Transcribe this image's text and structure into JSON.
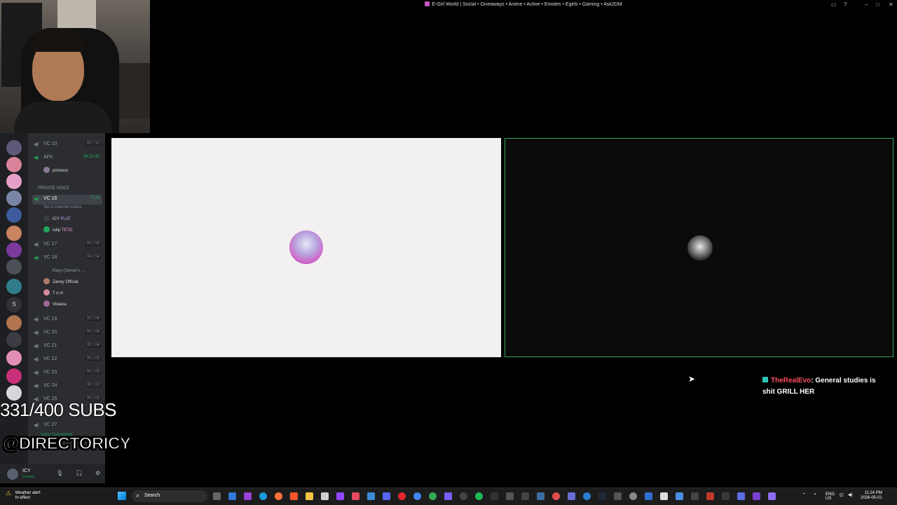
{
  "window": {
    "title": "E-Girl World | Social • Giveaways • Anime • Active • Emotes • Egirls • Gaming • Ask2DM"
  },
  "sidebar": {
    "channels": [
      {
        "name": "VC 10",
        "count": "00 | 10",
        "live": false,
        "active": false
      },
      {
        "name": "AFK",
        "count": "39:22:45",
        "live": true,
        "active": false
      }
    ],
    "afk_user": "princess",
    "category": "PRIVATE VOICE",
    "vc16": {
      "name": "VC 16",
      "count": "5:16",
      "status": "Set a channel status"
    },
    "vc16_users": [
      {
        "name": "ICY",
        "tag": "FLAT"
      },
      {
        "name": "tulip",
        "tag": "TETO"
      }
    ],
    "channels2": [
      {
        "name": "VC 17",
        "count": "00 | 05"
      },
      {
        "name": "VC 18",
        "count": "04 | 04"
      }
    ],
    "vc18_users": [
      {
        "name": "Ravy (Server's ..."
      },
      {
        "name": "Zaney Official"
      },
      {
        "name": "T o m"
      },
      {
        "name": "Viviana"
      }
    ],
    "channels3": [
      {
        "name": "VC 19",
        "count": "00 | 04"
      },
      {
        "name": "VC 20",
        "count": "00 | 04"
      },
      {
        "name": "VC 21",
        "count": "00 | 04"
      },
      {
        "name": "VC 22",
        "count": "00 | 03"
      },
      {
        "name": "VC 23",
        "count": "00 | 03"
      },
      {
        "name": "VC 24",
        "count": "00 | 03"
      },
      {
        "name": "VC 25",
        "count": "00 | 03"
      },
      {
        "name": "VC 27",
        "count": ""
      }
    ],
    "server_letter": "S",
    "voice_connected": "Voice Connected",
    "user": {
      "name": "ICY",
      "status": "In voice"
    }
  },
  "overlay": {
    "subs": "331/400 SUBS",
    "handle": "@DIRECTORICY"
  },
  "chat": {
    "author": "TheRealEvo",
    "message": ": General studies is shit GRILL HER"
  },
  "taskbar": {
    "weather_line1": "Weather alert",
    "weather_line2": "In effect",
    "search": "Search",
    "lang": "ENG",
    "region": "US",
    "time": "11:24 PM",
    "date": "2026-05-01"
  },
  "colors": {
    "speaking_border": "#3ba55c",
    "chat_author": "#ff4d5e",
    "discord_green": "#23a55a"
  }
}
